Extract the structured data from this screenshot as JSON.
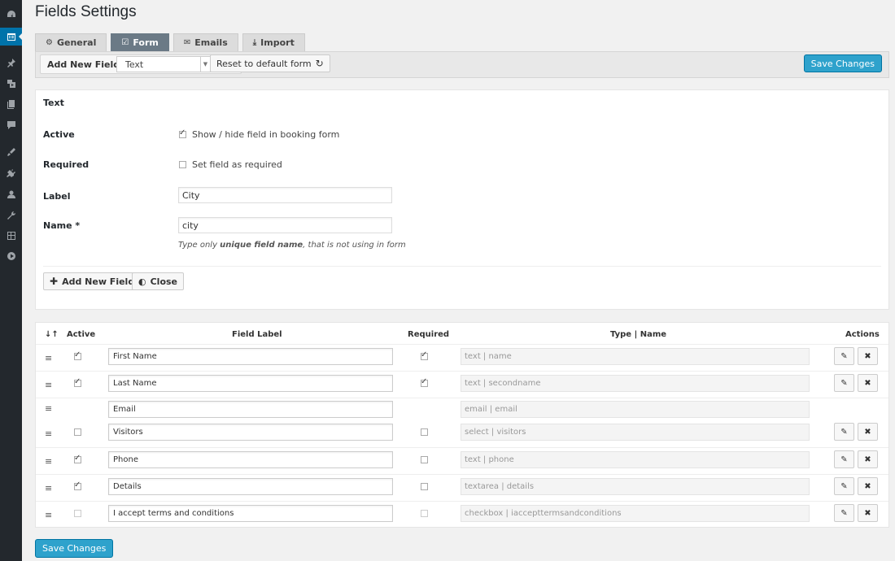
{
  "sidebar": {
    "items": [
      {
        "icon": "dashboard-icon"
      },
      {
        "icon": "booking-calendar-icon",
        "active": true
      },
      {
        "icon": "pin-icon"
      },
      {
        "icon": "media-icon"
      },
      {
        "icon": "pages-icon"
      },
      {
        "icon": "comments-icon"
      },
      {
        "icon": "appearance-icon"
      },
      {
        "icon": "plugins-icon"
      },
      {
        "icon": "users-icon"
      },
      {
        "icon": "tools-icon"
      },
      {
        "icon": "settings-icon"
      },
      {
        "icon": "play-icon"
      }
    ]
  },
  "page": {
    "title": "Fields Settings"
  },
  "tabs": [
    {
      "label": "General",
      "icon": "gear-icon",
      "active": false
    },
    {
      "label": "Form",
      "icon": "form-edit-icon",
      "active": true
    },
    {
      "label": "Emails",
      "icon": "envelope-icon",
      "active": false
    },
    {
      "label": "Import",
      "icon": "download-icon",
      "active": false
    }
  ],
  "toolbar": {
    "add_new_field_label": "Add New Field:",
    "field_type_value": "Text",
    "reset_label": "Reset to default form",
    "save_label": "Save Changes"
  },
  "editor": {
    "title": "Text",
    "active_label": "Active",
    "active_checkbox_label": "Show / hide field in booking form",
    "active_checked": true,
    "required_label": "Required",
    "required_checkbox_label": "Set field as required",
    "required_checked": false,
    "label_label": "Label",
    "label_value": "City",
    "name_label": "Name *",
    "name_value": "city",
    "hint_prefix": "Type only ",
    "hint_bold": "unique field name",
    "hint_suffix": ", that is not using in form",
    "add_button": "Add New Field",
    "close_button": "Close"
  },
  "table": {
    "headers": {
      "sort": "↓↑",
      "active": "Active",
      "label": "Field Label",
      "required": "Required",
      "type": "Type | Name",
      "actions": "Actions"
    },
    "rows": [
      {
        "label": "First Name",
        "type": "text | name",
        "active": true,
        "required": true,
        "actions": true
      },
      {
        "label": "Last Name",
        "type": "text | secondname",
        "active": true,
        "required": true,
        "actions": true
      },
      {
        "label": "Email",
        "type": "email | email",
        "active": null,
        "required": null,
        "actions": false
      },
      {
        "label": "Visitors",
        "type": "select | visitors",
        "active": false,
        "required": false,
        "actions": true
      },
      {
        "label": "Phone",
        "type": "text | phone",
        "active": true,
        "required": false,
        "actions": true
      },
      {
        "label": "Details",
        "type": "textarea | details",
        "active": true,
        "required": false,
        "actions": true
      },
      {
        "label": "I accept terms and conditions",
        "type": "checkbox | iaccepttermsandconditions",
        "active": false,
        "required": false,
        "actions": true
      }
    ]
  },
  "footer": {
    "save_label": "Save Changes"
  },
  "colors": {
    "primary": "#2ea2cc",
    "active_tab": "#6b7a86",
    "sidebar": "#23282d",
    "sidebar_active": "#0073aa"
  }
}
